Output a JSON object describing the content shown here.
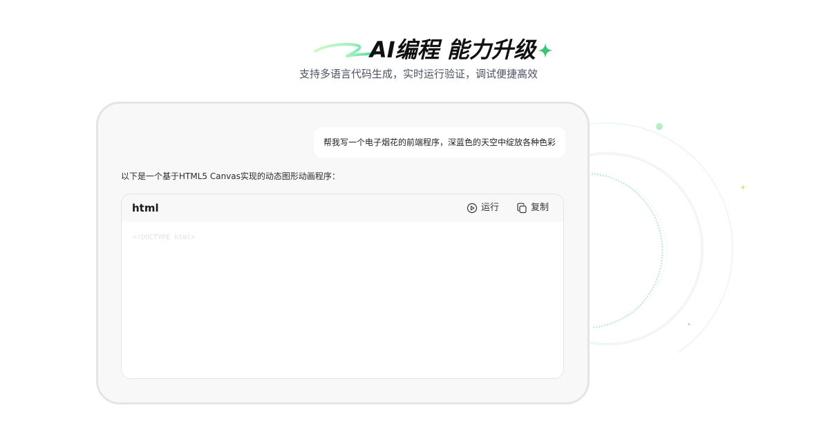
{
  "header": {
    "title": "AI编程 能力升级",
    "subtitle": "支持多语言代码生成，实时运行验证，调试便捷高效",
    "accent_color": "#3cc47a",
    "icons": [
      "swoosh-decoration",
      "sparkle-star-icon"
    ]
  },
  "chat": {
    "user_message": "帮我写一个电子烟花的前端程序，深蓝色的天空中绽放各种色彩",
    "assistant_intro": "以下是一个基于HTML5 Canvas实现的动态图形动画程序：",
    "code_block": {
      "language": "html",
      "run_label": "运行",
      "copy_label": "复制",
      "run_icon": "play-circle-icon",
      "copy_icon": "copy-icon",
      "code": "<!DOCTYPE html>"
    }
  }
}
